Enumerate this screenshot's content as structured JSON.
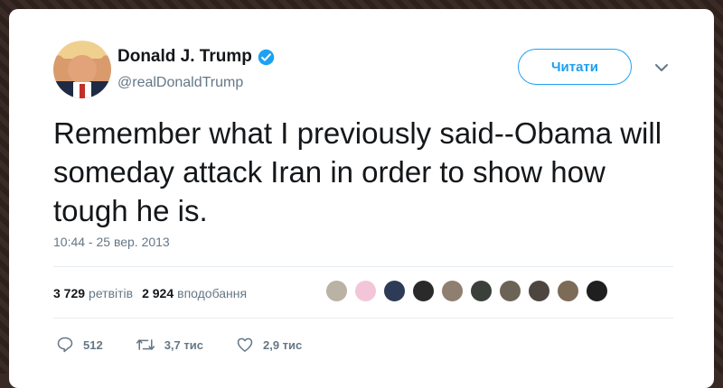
{
  "user": {
    "name": "Donald J. Trump",
    "handle": "@realDonaldTrump",
    "follow_label": "Читати"
  },
  "tweet": {
    "text": "Remember what I previously said--Obama will someday attack Iran in order to show how tough he is.",
    "timestamp": "10:44 - 25 вер. 2013"
  },
  "stats": {
    "retweets_count": "3 729",
    "retweets_label": "ретвітів",
    "likes_count": "2 924",
    "likes_label": "вподобання"
  },
  "actions": {
    "replies": "512",
    "retweets": "3,7 тис",
    "likes": "2,9 тис"
  },
  "colors": {
    "accent": "#1da1f2",
    "secondary_text": "#657786",
    "primary_text": "#14171a"
  },
  "likers": [
    {
      "color": "#b9b2a5"
    },
    {
      "color": "#f2c6d8"
    },
    {
      "color": "#2e3b57"
    },
    {
      "color": "#2a2a2a"
    },
    {
      "color": "#8e7f70"
    },
    {
      "color": "#3a3f3a"
    },
    {
      "color": "#6b6456"
    },
    {
      "color": "#4d4540"
    },
    {
      "color": "#7b6b57"
    },
    {
      "color": "#1f1f1f"
    }
  ]
}
